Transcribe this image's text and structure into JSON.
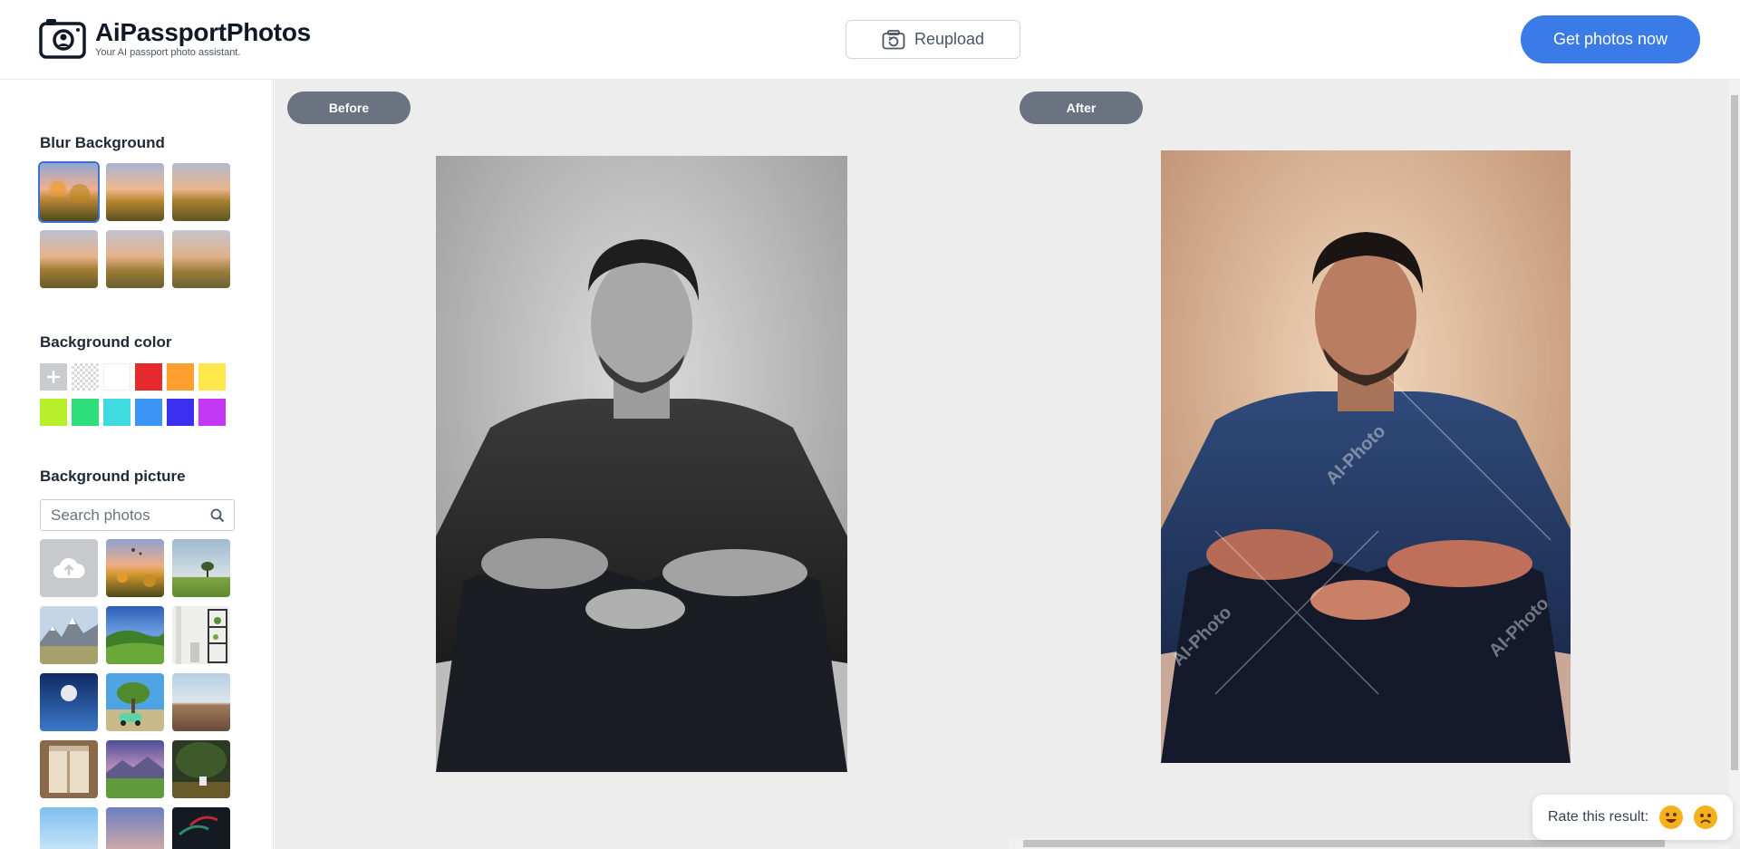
{
  "header": {
    "app_name": "AiPassportPhotos",
    "tagline": "Your AI passport photo assistant.",
    "reupload_label": "Reupload",
    "cta_label": "Get photos now",
    "brand_color": "#3b7be8"
  },
  "sidebar": {
    "blur_title": "Blur Background",
    "color_title": "Background color",
    "picture_title": "Background picture",
    "search_placeholder": "Search photos",
    "color_swatches": [
      "add",
      "transparent",
      "#ffffff",
      "#e52b2b",
      "#ff9f2f",
      "#ffe84a",
      "#b7f02a",
      "#2ede7a",
      "#3fdbe0",
      "#3b95f5",
      "#3b30f0",
      "#c337f5"
    ]
  },
  "main": {
    "before_label": "Before",
    "after_label": "After",
    "watermark": "AI-Photo"
  },
  "rating": {
    "label": "Rate this result:"
  }
}
